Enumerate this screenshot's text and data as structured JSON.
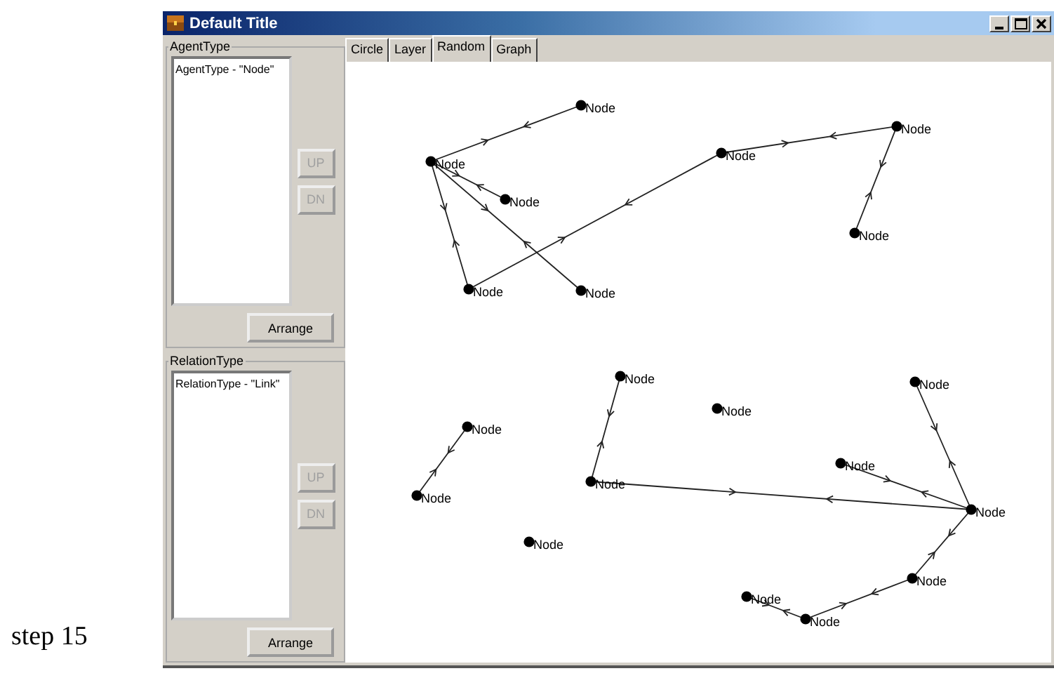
{
  "caption": "step 15",
  "window": {
    "title": "Default Title"
  },
  "panels": [
    {
      "title": "AgentType",
      "items": [
        {
          "label": "AgentType - \"Node\""
        }
      ],
      "buttons": [
        {
          "label": "UP",
          "disabled": true
        },
        {
          "label": "DN",
          "disabled": true
        }
      ],
      "action": "Arrange"
    },
    {
      "title": "RelationType",
      "items": [
        {
          "label": "RelationType - \"Link\""
        }
      ],
      "buttons": [
        {
          "label": "UP",
          "disabled": true
        },
        {
          "label": "DN",
          "disabled": true
        }
      ],
      "action": "Arrange"
    }
  ],
  "tabs": [
    {
      "label": "Circle",
      "selected": false
    },
    {
      "label": "Layer",
      "selected": false
    },
    {
      "label": "Random",
      "selected": true
    },
    {
      "label": "Graph",
      "selected": false
    }
  ],
  "graph": {
    "nodes": [
      {
        "label": "Node"
      },
      {
        "label": "Node"
      },
      {
        "label": "Node"
      },
      {
        "label": "Node"
      },
      {
        "label": "Node"
      },
      {
        "label": "Node"
      },
      {
        "label": "Node"
      },
      {
        "label": "Node"
      },
      {
        "label": "Node"
      },
      {
        "label": "Node"
      },
      {
        "label": "Node"
      },
      {
        "label": "Node"
      },
      {
        "label": "Node"
      },
      {
        "label": "Node"
      },
      {
        "label": "Node"
      },
      {
        "label": "Node"
      },
      {
        "label": "Node"
      },
      {
        "label": "Node"
      },
      {
        "label": "Node"
      },
      {
        "label": "Node"
      }
    ]
  }
}
